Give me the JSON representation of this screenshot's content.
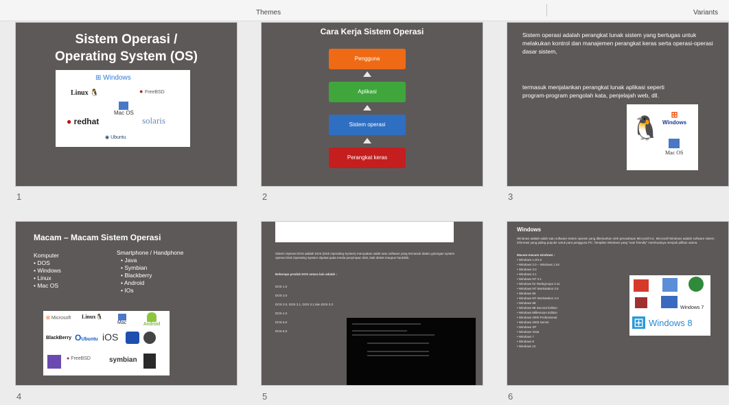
{
  "topbar": {
    "themes": "Themes",
    "variants": "Variants"
  },
  "slides": [
    {
      "number": "1",
      "title_line1": "Sistem Operasi /",
      "title_line2": "Operating System (OS)",
      "logos": [
        "Windows",
        "Linux",
        "FreeBSD",
        "Mac OS",
        "redhat",
        "solaris",
        "Ubuntu"
      ]
    },
    {
      "number": "2",
      "title": "Cara Kerja Sistem Operasi",
      "layers": [
        "Pengguna",
        "Aplikasi",
        "Sistem operasi",
        "Perangkat keras"
      ]
    },
    {
      "number": "3",
      "para1": "Sistem operasi adalah perangkat lunak sistem yang bertugas untuk melakukan kontrol dan manajemen perangkat keras serta operasi-operasi dasar sistem,",
      "para2": "termasuk menjalankan perangkat lunak aplikasi seperti program-program pengolah kata, penjelajah web, dll.",
      "logos": [
        "Windows",
        "Mac OS"
      ]
    },
    {
      "number": "4",
      "title": "Macam – Macam Sistem Operasi",
      "col1_title": "Komputer",
      "col1_items": [
        "DOS",
        "Windows",
        "Linux",
        "Mac OS"
      ],
      "col2_title": "Smartphone / Handphone",
      "col2_items": [
        "Java",
        "Symbian",
        "Blackberry",
        "Android",
        "IOs"
      ],
      "logos": [
        "Microsoft",
        "Linux",
        "Mac",
        "Android",
        "BlackBerry",
        "Ubuntu",
        "iOS",
        "FreeBSD",
        "symbian"
      ]
    },
    {
      "number": "5",
      "para": "Sistem Operasi DOS adalah DOS (Disk Operating System) merupakan salah satu software yang termasuk dalam golongan system operasi Disk Operating System dipakai pada media penyimpan disk, baik disket maupun harddisk.",
      "versions_title": "Beberapa produk DOS antara lain adalah :",
      "versions": [
        "DOS 1.0",
        "DOS 2.0",
        "DOS 3.0, DOS 3.1, DOS 3.2 dan DOS 3.3",
        "DOS 4.0",
        "DOS 5.0",
        "DOS 6.0"
      ]
    },
    {
      "number": "6",
      "title": "Windows",
      "para": "Windows adalah salah satu software sistem operasi yang dikeluarkan oleh perusahaan Microsoft Inc. Microsoft Windows adalah software sistem informasi yang paling populer untuk para pengguna PC. Tampilan Windows yang \"user friendly\" membuatnya menjadi pilihan utama.",
      "list_title": "Macam-macam windows :",
      "items": [
        "Windows 1.0/1.0",
        "Windows 2.0 – Windows 1.04",
        "Windows 3.0",
        "Windows 3.1",
        "Windows NT 3.1",
        "Windows for Workgroups 3.11",
        "Windows NT Workstation 3.5",
        "Windows 95",
        "Windows NT Workstation 4.0",
        "Windows 98",
        "Windows 98 Second Edition",
        "Windows Millennium Edition",
        "Windows 2000 Professional",
        "Windows 2003 Server",
        "Windows XP",
        "Windows Vista",
        "Windows 7",
        "Windows 8",
        "Windows 10"
      ],
      "logos": [
        "Windows 7",
        "Windows 8"
      ]
    }
  ]
}
